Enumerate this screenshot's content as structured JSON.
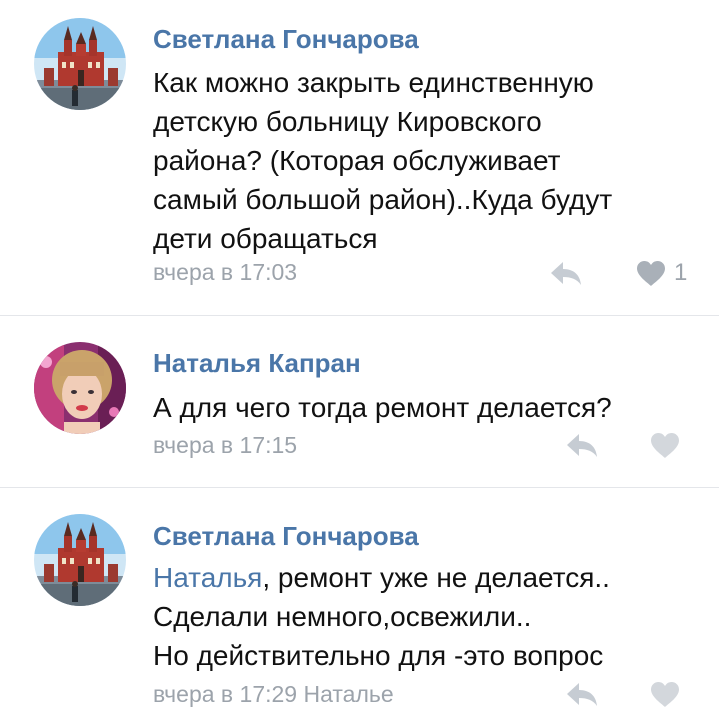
{
  "comments": [
    {
      "author": "Светлана Гончарова",
      "lines": [
        "Как можно закрыть единственную",
        "детскую больницу Кировского",
        "района? (Которая обслуживает",
        "самый большой район)..Куда будут",
        "дети обращаться"
      ],
      "timestamp": "вчера в 17:03",
      "likes": "1",
      "avatar_icon": "kremlin-photo-avatar"
    },
    {
      "author": "Наталья Капран",
      "lines": [
        "А для чего тогда ремонт делается?"
      ],
      "timestamp": "вчера в 17:15",
      "likes": "",
      "avatar_icon": "woman-photo-avatar"
    },
    {
      "author": "Светлана Гончарова",
      "mention": "Наталья",
      "first_line_rest": ", ремонт уже не делается..",
      "lines": [
        "Сделали немного,освежили..",
        "Но действительно для -это вопрос"
      ],
      "timestamp": "вчера в 17:29 Наталье",
      "likes": "",
      "avatar_icon": "kremlin-photo-avatar"
    }
  ],
  "colors": {
    "author": "#4a76a8",
    "text": "#111111",
    "meta": "#9ca3ab",
    "like_liked": "#a9b0b8",
    "like_empty": "#d3d7dc",
    "divider": "#e4e6ea"
  },
  "icons": {
    "reply": "reply-arrow-icon",
    "like": "heart-icon"
  }
}
